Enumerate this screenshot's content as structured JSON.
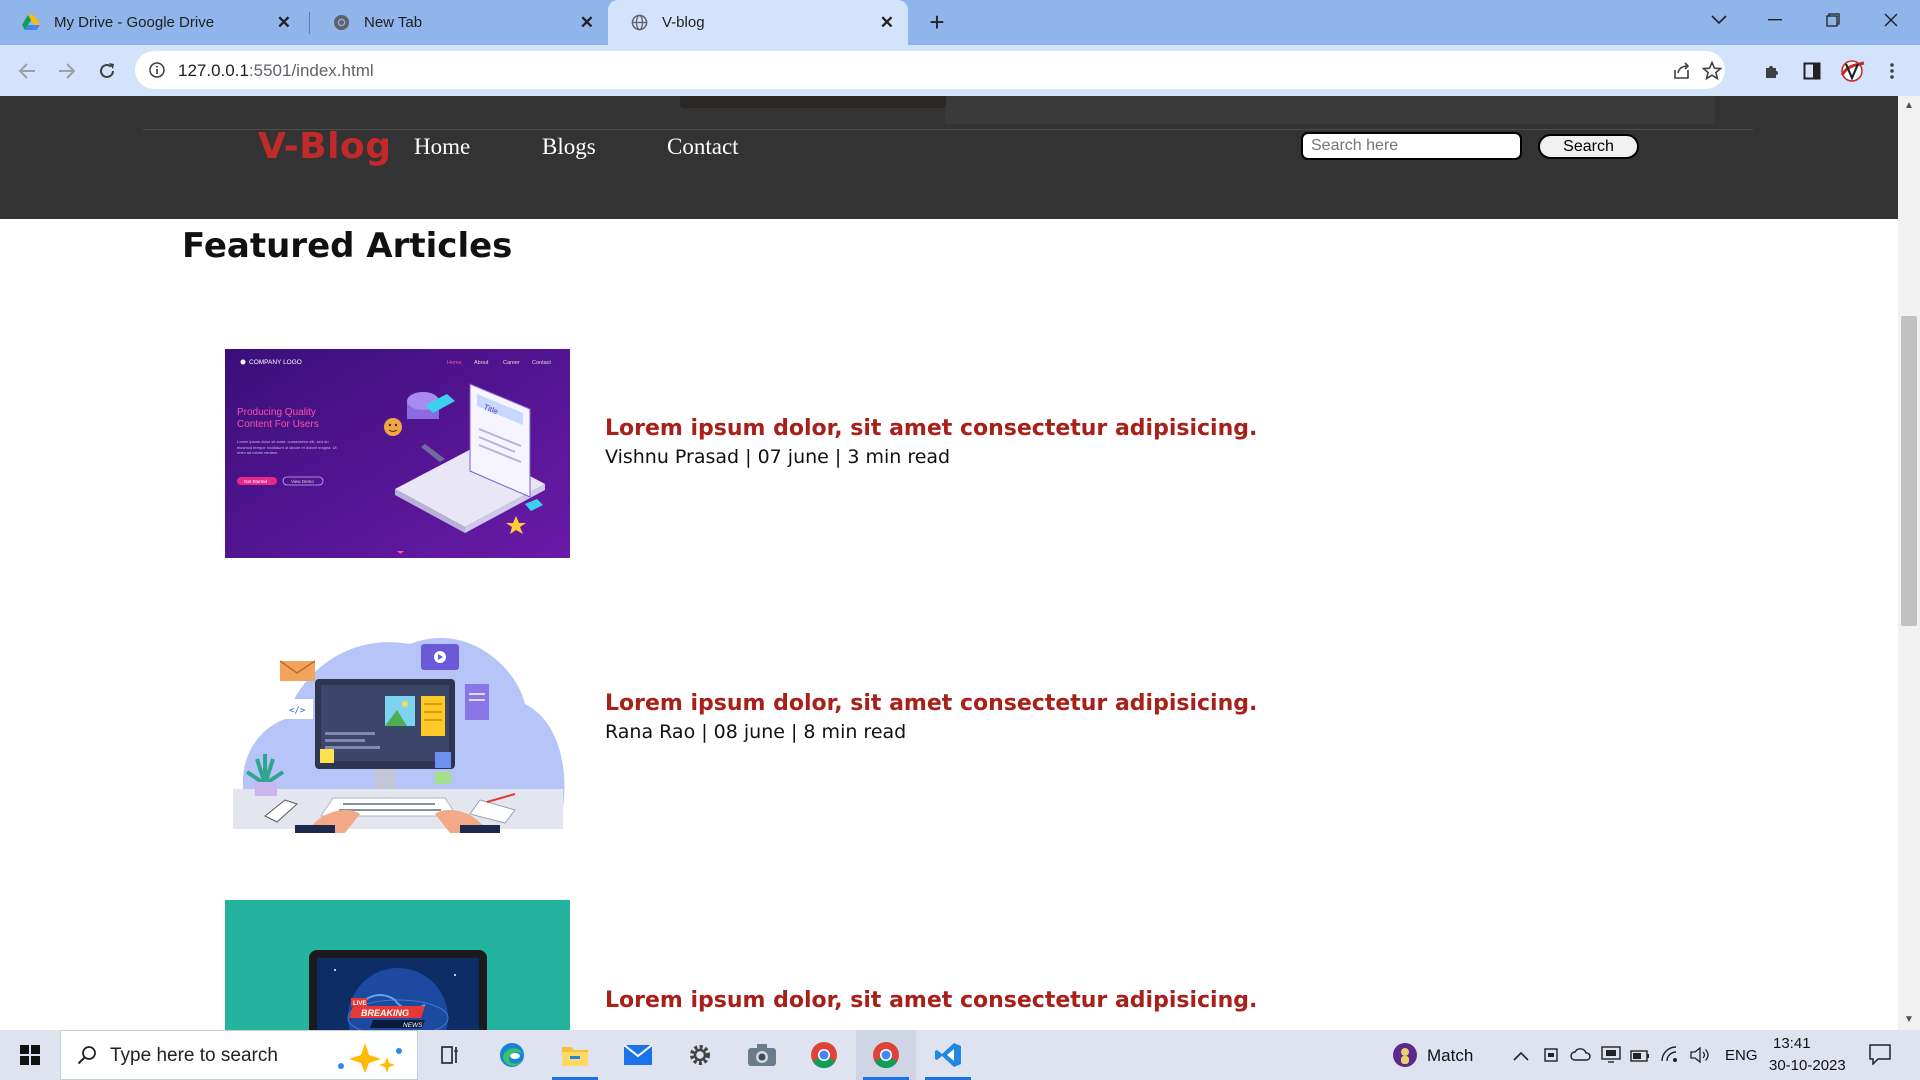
{
  "browser": {
    "tabs": [
      {
        "title": "My Drive - Google Drive",
        "icon": "google-drive-icon",
        "active": false
      },
      {
        "title": "New Tab",
        "icon": "chrome-icon",
        "active": false
      },
      {
        "title": "V-blog",
        "icon": "globe-icon",
        "active": true
      }
    ],
    "url_host": "127.0.0.1",
    "url_rest": ":5501/index.html"
  },
  "site": {
    "logo": "V-Blog",
    "nav": [
      "Home",
      "Blogs",
      "Contact"
    ],
    "search_placeholder": "Search here",
    "search_button": "Search",
    "section_title": "Featured Articles",
    "articles": [
      {
        "title": "Lorem ipsum dolor, sit amet consectetur adipisicing.",
        "meta": "Vishnu Prasad | 07 june | 3 min read"
      },
      {
        "title": "Lorem ipsum dolor, sit amet consectetur adipisicing.",
        "meta": "Rana Rao | 08 june | 8 min read"
      },
      {
        "title": "Lorem ipsum dolor, sit amet consectetur adipisicing.",
        "meta": ""
      }
    ],
    "thumb1": {
      "logo": "COMPANY LOGO",
      "menu": [
        "Home",
        "About",
        "Career",
        "Contact"
      ],
      "headline": "Producing Quality Content For Users",
      "body": "Lorem ipsum dolor sit amet, consectetur elit, sed do eiusmod tempor incididunt ut labore et dolore magna. Ut enim ad minim veniam.",
      "btn1": "Get Started",
      "btn2": "View Demo",
      "card": "Title"
    },
    "thumb3": {
      "banner": "BREAKING",
      "sub": "NEWS",
      "live": "LIVE"
    }
  },
  "taskbar": {
    "search_placeholder": "Type here to search",
    "weather": "Match",
    "lang": "ENG",
    "time": "13:41",
    "date": "30-10-2023"
  },
  "colors": {
    "tab_strip": "#8fb5ea",
    "toolbar": "#d3e3fb",
    "navbar": "#333333",
    "logo": "#c22a2a",
    "article_title": "#a8201a"
  }
}
